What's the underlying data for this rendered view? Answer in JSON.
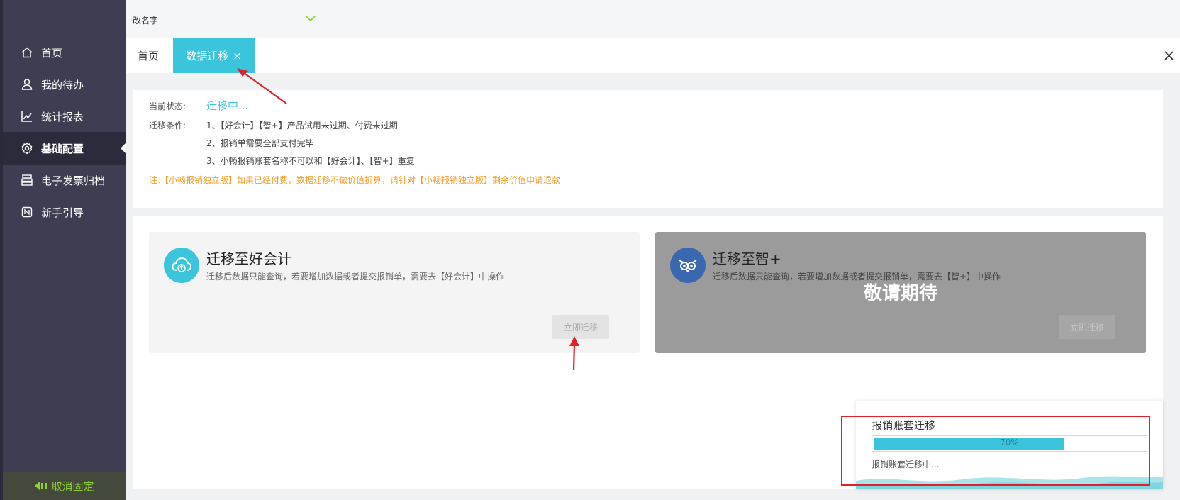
{
  "sidebar": {
    "items": [
      {
        "label": "首页",
        "icon": "home-icon"
      },
      {
        "label": "我的待办",
        "icon": "user-todo-icon"
      },
      {
        "label": "统计报表",
        "icon": "chart-icon"
      },
      {
        "label": "基础配置",
        "icon": "gear-icon"
      },
      {
        "label": "电子发票归档",
        "icon": "invoice-archive-icon"
      },
      {
        "label": "新手引导",
        "icon": "guide-icon"
      }
    ],
    "active_index": 3,
    "unpin_label": "取消固定"
  },
  "header": {
    "company_name": "改名字"
  },
  "tabs": {
    "home_label": "首页",
    "active_label": "数据迁移",
    "close_glyph": "×"
  },
  "status": {
    "state_label": "当前状态:",
    "state_value": "迁移中...",
    "conditions_label": "迁移条件:",
    "conditions": [
      "1、【好会计】【智+】产品试用未过期、付费未过期",
      "2、报销单需要全部支付完毕",
      "3、小畅报销账套名称不可以和【好会计】、【智+】重复"
    ],
    "note": "注:【小畅报销独立版】如果已经付费，数据迁移不做价值折算，请针对【小畅报销独立版】剩余价值申请退款"
  },
  "cards": {
    "hkj": {
      "title": "迁移至好会计",
      "desc": "迁移后数据只能查询，若要增加数据或者提交报销单，需要去【好会计】中操作",
      "button": "立即迁移"
    },
    "zhi": {
      "title": "迁移至智+",
      "desc": "迁移后数据只能查询，若要增加数据或者提交报销单，需要去【智+】中操作",
      "button": "立即迁移",
      "overlay": "敬请期待"
    }
  },
  "progress": {
    "title": "报销账套迁移",
    "percent": 70,
    "percent_text": "70%",
    "status_text": "报销账套迁移中..."
  },
  "colors": {
    "accent": "#3bc5dc",
    "sidebar": "#3d3e52",
    "note": "#f59a23",
    "annotation": "#e0202a"
  }
}
